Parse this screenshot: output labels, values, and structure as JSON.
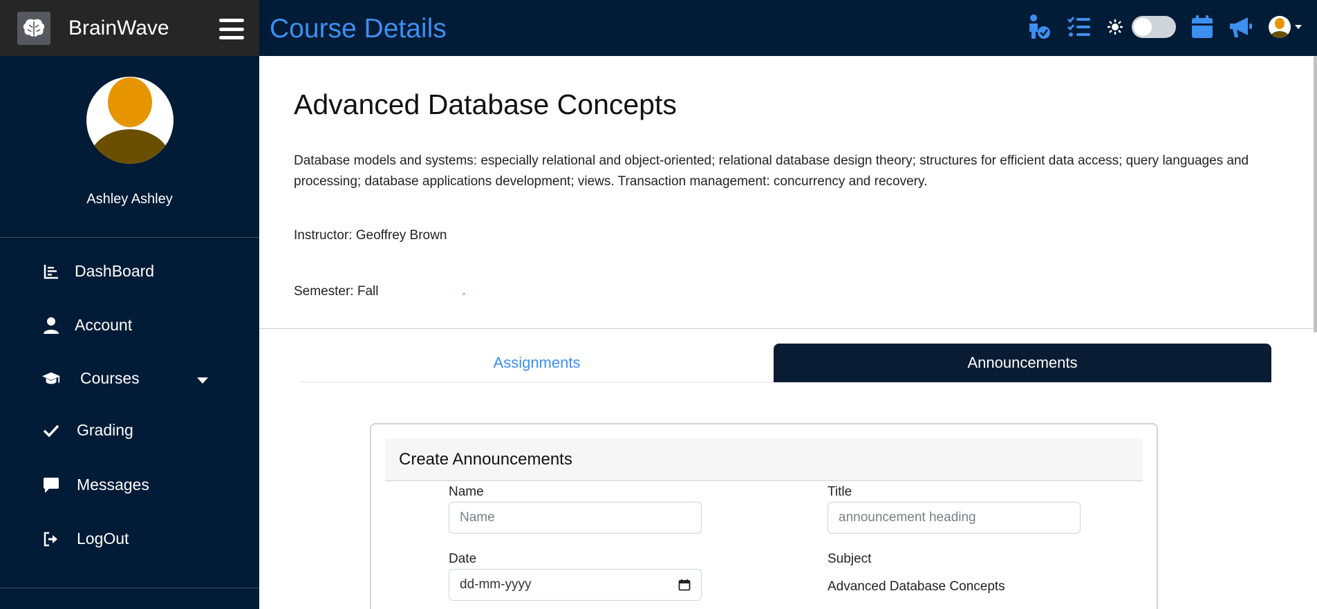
{
  "brand": {
    "name": "BrainWave"
  },
  "header": {
    "title": "Course Details",
    "icons": [
      "person-check-icon",
      "task-list-icon",
      "sun-icon",
      "theme-toggle",
      "calendar-icon",
      "megaphone-icon",
      "user-avatar"
    ]
  },
  "sidebar": {
    "user_name": "Ashley Ashley",
    "items": [
      {
        "label": "DashBoard",
        "icon": "chart-icon"
      },
      {
        "label": "Account",
        "icon": "user-icon"
      },
      {
        "label": "Courses",
        "icon": "graduation-cap-icon"
      },
      {
        "label": "Grading",
        "icon": "check-icon"
      },
      {
        "label": "Messages",
        "icon": "chat-icon"
      },
      {
        "label": "LogOut",
        "icon": "logout-icon"
      }
    ]
  },
  "course": {
    "name": "Advanced Database Concepts",
    "description": "Database models and systems: especially relational and object-oriented; relational database design theory; structures for efficient data access; query languages and processing; database applications development; views. Transaction management: concurrency and recovery.",
    "instructor": "Instructor: Geoffrey Brown",
    "semester": "Semester: Fall"
  },
  "tabs": [
    {
      "label": "Assignments",
      "active": false
    },
    {
      "label": "Announcements",
      "active": true
    }
  ],
  "announcement_form": {
    "title": "Create Announcements",
    "name_label": "Name",
    "name_placeholder": "Name",
    "title_label": "Title",
    "title_placeholder": "announcement heading",
    "date_label": "Date",
    "date_placeholder": "dd-mm-yyyy",
    "subject_label": "Subject",
    "subject_value": "Advanced Database Concepts"
  },
  "colors": {
    "navy": "#021b36",
    "accent": "#3d8ff0",
    "avatar": "#e69500"
  }
}
